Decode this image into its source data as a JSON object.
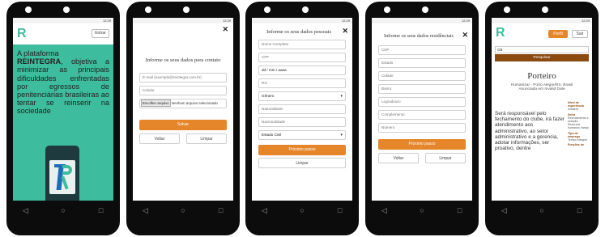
{
  "status_time": "12:29",
  "logo_letter": "R",
  "colors": {
    "teal": "#3dbd9d",
    "orange": "#e5862a",
    "blue": "#1f6bb7",
    "brown": "#8a4a10"
  },
  "screen1": {
    "enter_label": "Entrar",
    "lead": "A plataforma",
    "brand": "REINTEGRA",
    "body": ", objetiva a minimizar as principais dificuldades enfrentadas por egressos de penitenciárias brasileiras ao tentar se reinserir na sociedade"
  },
  "screen2": {
    "title": "Informe os seus dados para contato",
    "email_placeholder": "E-mail (exemplo@reintegra.com.br)",
    "phone_placeholder": "Celular",
    "file_button": "Escolher arquivo",
    "file_status": "Nenhum arquivo selecionado",
    "save": "Salvar",
    "back": "Voltar",
    "clear": "Limpar"
  },
  "screen3": {
    "title": "Informe os seus dados pessoais",
    "fields": [
      "Nome Completo",
      "CPF",
      "dd / mm / aaaa",
      "RG"
    ],
    "gender": "Gênero",
    "fields2": [
      "Naturalidade",
      "Nacionalidade"
    ],
    "civil": "Estado Civil",
    "next": "Próximo passo",
    "clear": "Limpar"
  },
  "screen4": {
    "title": "Informe os seus dados residênciais",
    "fields": [
      "CEP",
      "Estado",
      "Cidade",
      "Bairro",
      "Logradouro",
      "Complemento",
      "Número"
    ],
    "next": "Próximo passo",
    "back": "Voltar",
    "clear": "Limpar"
  },
  "screen5": {
    "profile": "Perfil",
    "logout": "Sair",
    "search_value": "Ott",
    "search_button": "Pesquisar",
    "job_title": "Porteiro",
    "company": "Humanizar - Porto Alegre/RS, Brasil",
    "posted": "Anunciada em Invalid Date",
    "description": "Será responsável pelo fechamento do clube, irá fazer atendimento aos administrativo, ao setor administrativo e a gerencia, adotar informações, ser proativo, dentre",
    "side": [
      {
        "label": "Nível de experiência",
        "value": "Iniciante"
      },
      {
        "label": "Setor",
        "value": "Recrutamento e seleção Recursos humanos Varejo"
      },
      {
        "label": "Tipo de emprego",
        "value": "Tempo integral"
      },
      {
        "label": "Funções de",
        "value": ""
      }
    ]
  }
}
